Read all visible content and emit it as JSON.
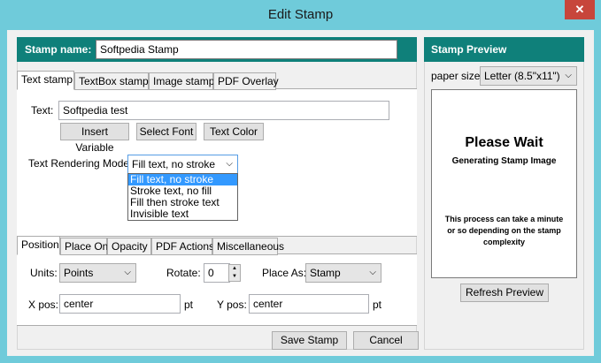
{
  "window": {
    "title": "Edit Stamp",
    "close_glyph": "✕"
  },
  "stamp_name": {
    "label": "Stamp name:",
    "value": "Softpedia Stamp"
  },
  "top_tabs": [
    {
      "label": "Text stamp",
      "active": true
    },
    {
      "label": "TextBox stamp",
      "active": false
    },
    {
      "label": "Image stamp",
      "active": false
    },
    {
      "label": "PDF Overlay",
      "active": false
    }
  ],
  "text_tab": {
    "text_label": "Text:",
    "text_value": "Softpedia test",
    "insert_variable": "Insert Variable",
    "select_font": "Select Font",
    "text_color": "Text Color",
    "rendering_label": "Text Rendering Mode:",
    "rendering_value": "Fill text, no stroke",
    "rendering_options": [
      "Fill text, no stroke",
      "Stroke text, no fill",
      "Fill then stroke text",
      "Invisible text"
    ]
  },
  "bottom_tabs": [
    {
      "label": "Position",
      "active": true
    },
    {
      "label": "Place On",
      "active": false
    },
    {
      "label": "Opacity",
      "active": false
    },
    {
      "label": "PDF Actions",
      "active": false
    },
    {
      "label": "Miscellaneous",
      "active": false
    }
  ],
  "position_tab": {
    "units_label": "Units:",
    "units_value": "Points",
    "rotate_label": "Rotate:",
    "rotate_value": "0",
    "place_as_label": "Place As:",
    "place_as_value": "Stamp",
    "xpos_label": "X pos:",
    "xpos_value": "center",
    "xpos_unit": "pt",
    "ypos_label": "Y pos:",
    "ypos_value": "center",
    "ypos_unit": "pt"
  },
  "buttons": {
    "save": "Save Stamp",
    "cancel": "Cancel"
  },
  "preview": {
    "title": "Stamp Preview",
    "paper_size_label": "paper size:",
    "paper_size_value": "Letter (8.5\"x11\")",
    "please_wait": "Please Wait",
    "generating": "Generating Stamp Image",
    "note": "This process can take a minute or so depending on the stamp complexity",
    "refresh": "Refresh Preview"
  },
  "colors": {
    "accent": "#0f807a",
    "title_bar": "#6fcbda",
    "close": "#c7463b",
    "selection": "#3399ff"
  },
  "icons": {
    "dropdown": "chevron-down-icon",
    "spinner_up": "triangle-up-icon",
    "spinner_down": "triangle-down-icon"
  }
}
